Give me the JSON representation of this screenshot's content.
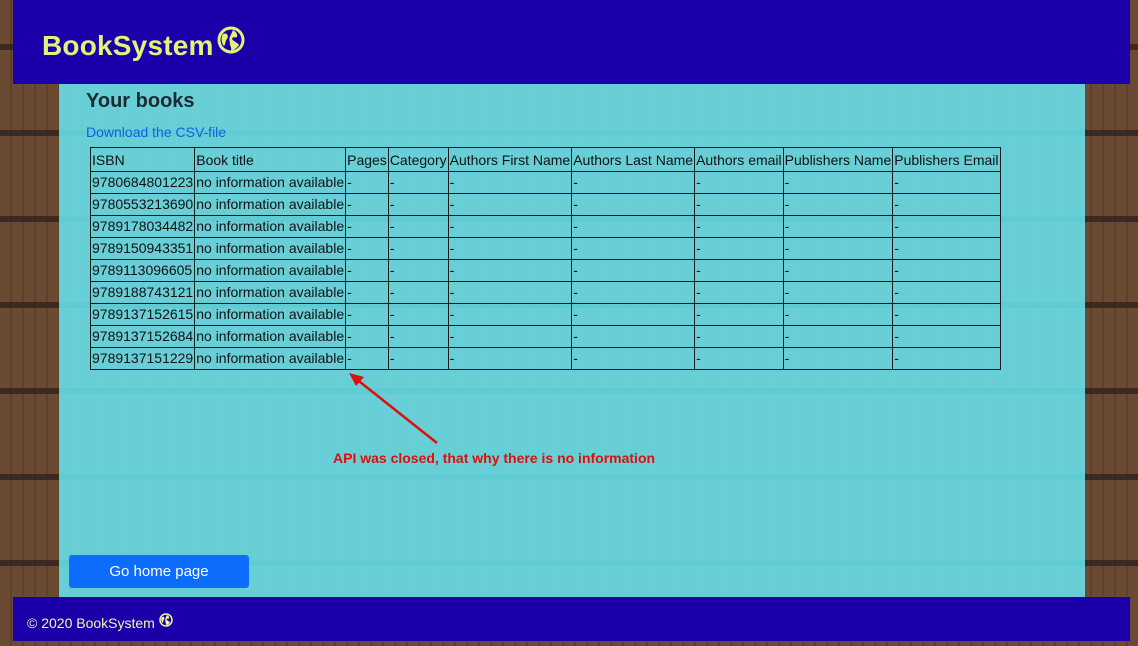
{
  "header": {
    "brand": "BookSystem",
    "brand_icon": "globe-icon"
  },
  "page": {
    "title": "Your books",
    "csv_link": "Download the CSV-file"
  },
  "table": {
    "columns": [
      "ISBN",
      "Book title",
      "Pages",
      "Category",
      "Authors First Name",
      "Authors Last Name",
      "Authors email",
      "Publishers Name",
      "Publishers Email"
    ],
    "rows": [
      [
        "9780684801223",
        "no information available",
        "-",
        "-",
        "-",
        "-",
        "-",
        "-",
        "-"
      ],
      [
        "9780553213690",
        "no information available",
        "-",
        "-",
        "-",
        "-",
        "-",
        "-",
        "-"
      ],
      [
        "9789178034482",
        "no information available",
        "-",
        "-",
        "-",
        "-",
        "-",
        "-",
        "-"
      ],
      [
        "9789150943351",
        "no information available",
        "-",
        "-",
        "-",
        "-",
        "-",
        "-",
        "-"
      ],
      [
        "9789113096605",
        "no information available",
        "-",
        "-",
        "-",
        "-",
        "-",
        "-",
        "-"
      ],
      [
        "9789188743121",
        "no information available",
        "-",
        "-",
        "-",
        "-",
        "-",
        "-",
        "-"
      ],
      [
        "9789137152615",
        "no information available",
        "-",
        "-",
        "-",
        "-",
        "-",
        "-",
        "-"
      ],
      [
        "9789137152684",
        "no information available",
        "-",
        "-",
        "-",
        "-",
        "-",
        "-",
        "-"
      ],
      [
        "9789137151229",
        "no information available",
        "-",
        "-",
        "-",
        "-",
        "-",
        "-",
        "-"
      ]
    ]
  },
  "annotation": {
    "text": "API was closed, that why there is no information",
    "color": "#e00d0d"
  },
  "buttons": {
    "home": "Go home page"
  },
  "footer": {
    "text": "© 2020 BookSystem",
    "icon": "globe-icon"
  },
  "colors": {
    "bar": "#1b00a9",
    "brand_text": "#e5f27a",
    "panel": "#68e5f2",
    "button": "#0d6efd"
  }
}
